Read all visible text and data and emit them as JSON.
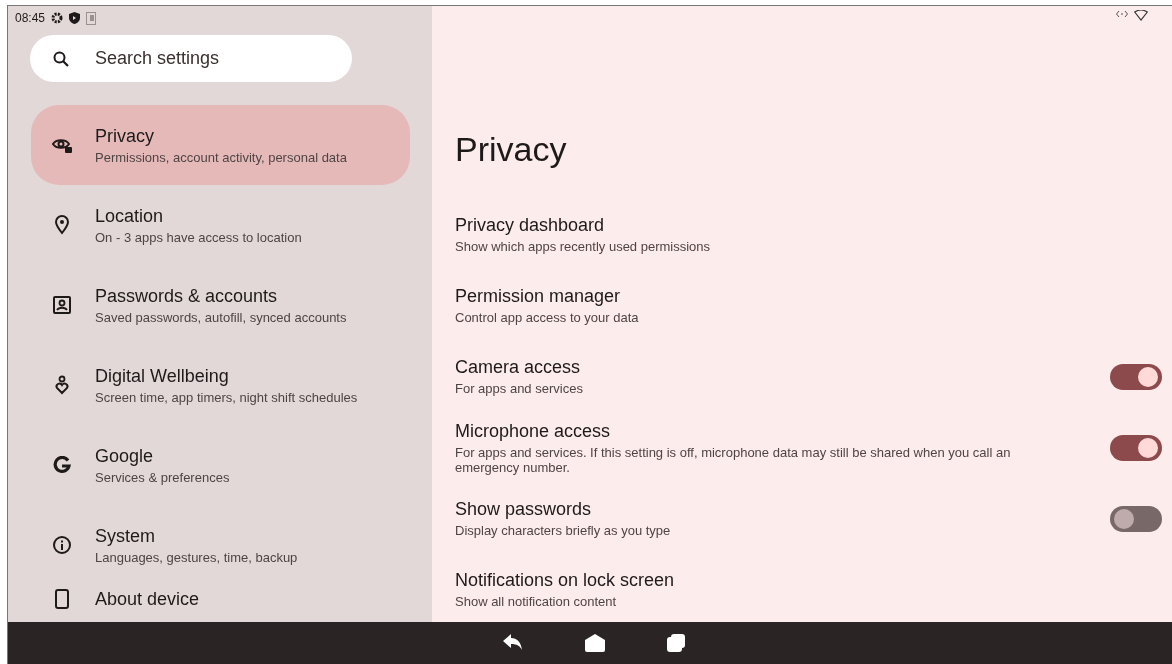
{
  "status_bar": {
    "time": "08:45"
  },
  "search": {
    "placeholder": "Search settings"
  },
  "sidebar": {
    "items": [
      {
        "kind": "privacy",
        "title": "Privacy",
        "subtitle": "Permissions, account activity, personal data",
        "selected": true
      },
      {
        "kind": "location",
        "title": "Location",
        "subtitle": "On - 3 apps have access to location",
        "selected": false
      },
      {
        "kind": "account",
        "title": "Passwords & accounts",
        "subtitle": "Saved passwords, autofill, synced accounts",
        "selected": false
      },
      {
        "kind": "wellbeing",
        "title": "Digital Wellbeing",
        "subtitle": "Screen time, app timers, night shift schedules",
        "selected": false
      },
      {
        "kind": "google",
        "title": "Google",
        "subtitle": "Services & preferences",
        "selected": false
      },
      {
        "kind": "info",
        "title": "System",
        "subtitle": "Languages, gestures, time, backup",
        "selected": false
      },
      {
        "kind": "device",
        "title": "About device",
        "selected": false
      }
    ]
  },
  "page": {
    "title": "Privacy",
    "rows": [
      {
        "kind": "link",
        "title": "Privacy dashboard",
        "subtitle": "Show which apps recently used permissions"
      },
      {
        "kind": "link",
        "title": "Permission manager",
        "subtitle": "Control app access to your data"
      },
      {
        "kind": "toggle",
        "title": "Camera access",
        "subtitle": "For apps and services",
        "on": true
      },
      {
        "kind": "toggle",
        "title": "Microphone access",
        "subtitle": "For apps and services. If this setting is off, microphone data may still be shared when you call an emergency number.",
        "on": true
      },
      {
        "kind": "toggle",
        "title": "Show passwords",
        "subtitle": "Display characters briefly as you type",
        "on": false
      },
      {
        "kind": "link",
        "title": "Notifications on lock screen",
        "subtitle": "Show all notification content"
      }
    ]
  }
}
